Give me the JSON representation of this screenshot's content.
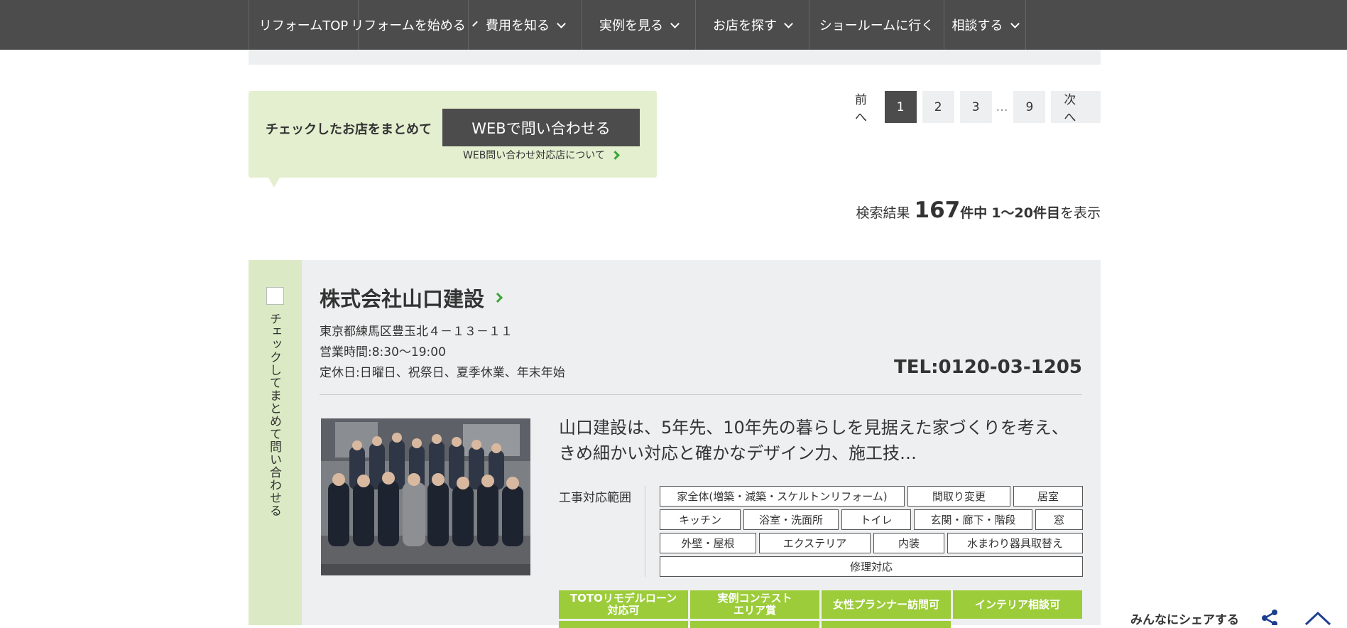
{
  "nav": {
    "items": [
      {
        "label": "リフォームTOP",
        "chevron": false
      },
      {
        "label": "リフォームを始める",
        "chevron": true
      },
      {
        "label": "費用を知る",
        "chevron": true
      },
      {
        "label": "実例を見る",
        "chevron": true
      },
      {
        "label": "お店を探す",
        "chevron": true
      },
      {
        "label": "ショールームに行く",
        "chevron": false
      },
      {
        "label": "相談する",
        "chevron": true
      }
    ]
  },
  "bulk": {
    "label": "チェックしたお店をまとめて",
    "button": "WEBで問い合わせる",
    "link": "WEB問い合わせ対応店について"
  },
  "pagination": {
    "prev": "前へ",
    "pages": [
      "1",
      "2",
      "3"
    ],
    "active": "1",
    "ellipsis": "…",
    "last": "9",
    "next": "次へ"
  },
  "results": {
    "prefix": "検索結果",
    "total": "167",
    "mid": "件中",
    "range": "1〜20件目",
    "suffix": "を表示"
  },
  "shop": {
    "check_label": "チェックしてまとめて問い合わせる",
    "name": "株式会社山口建設",
    "address": "東京都練馬区豊玉北４－１３－１１",
    "hours": "営業時間:8:30〜19:00",
    "holidays": "定休日:日曜日、祝祭日、夏季休業、年末年始",
    "tel": "TEL:0120-03-1205",
    "description": "山口建設は、5年先、10年先の暮らしを見据えた家づくりを考え、きめ細かい対応と確かなデザイン力、施工技…",
    "scope_label": "工事対応範囲",
    "tags": [
      [
        "家全体(増築・減築・スケルトンリフォーム)",
        "間取り変更",
        "居室"
      ],
      [
        "キッチン",
        "浴室・洗面所",
        "トイレ",
        "玄関・廊下・階段",
        "窓"
      ],
      [
        "外壁・屋根",
        "エクステリア",
        "内装",
        "水まわり器具取替え"
      ],
      [
        "修理対応"
      ]
    ],
    "badges": [
      "TOTOリモデルローン\n対応可",
      "実例コンテスト\nエリア賞",
      "女性プランナー訪問可",
      "インテリア相談可"
    ]
  },
  "share": {
    "label": "みんなにシェアする"
  },
  "colors": {
    "nav_bg": "#4c4c4c",
    "bulk_bg": "#e3efcf",
    "card_bg": "#eeeff0",
    "accent_green": "#3aa635",
    "badge_green": "#9ccc3a"
  }
}
